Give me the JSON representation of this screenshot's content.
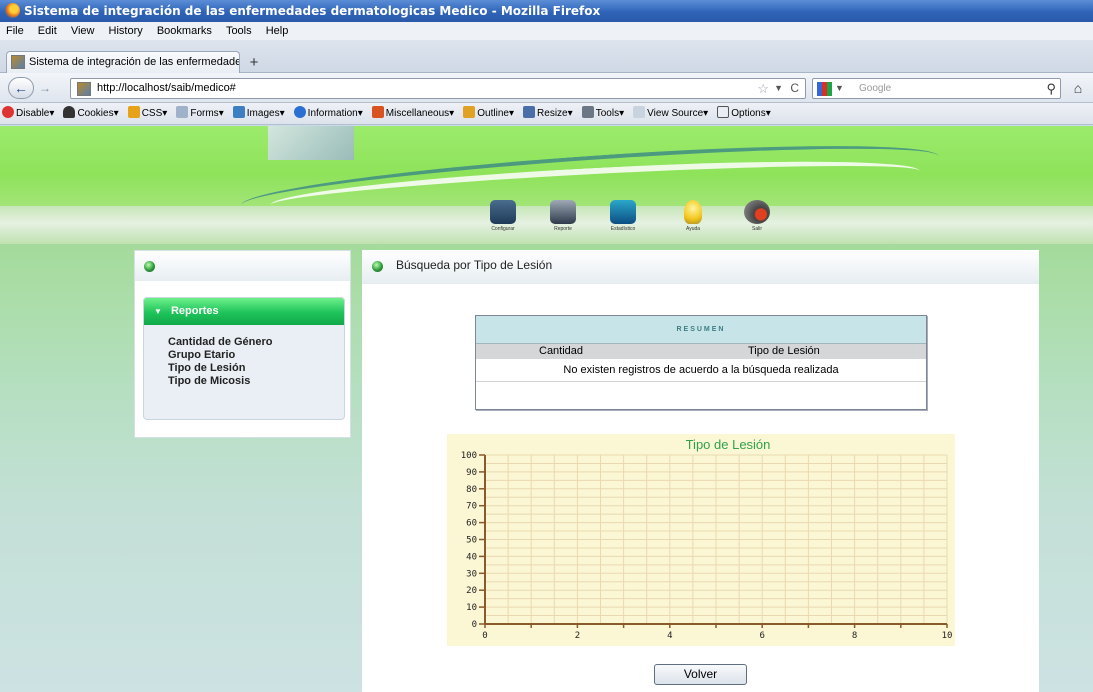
{
  "window": {
    "title": "Sistema de integración de las enfermedades dermatologicas Medico - Mozilla Firefox"
  },
  "menu": [
    "File",
    "Edit",
    "View",
    "History",
    "Bookmarks",
    "Tools",
    "Help"
  ],
  "tab": {
    "label": "Sistema de integración de las enfermedades ...",
    "new_tab": "+"
  },
  "navbar": {
    "url": "http://localhost/saib/medico#",
    "search_placeholder": "Google"
  },
  "devbar": [
    "Disable",
    "Cookies",
    "CSS",
    "Forms",
    "Images",
    "Information",
    "Miscellaneous",
    "Outline",
    "Resize",
    "Tools",
    "View Source",
    "Options"
  ],
  "site_nav": [
    "Configurar",
    "Reporte",
    "Estadístico",
    "Ayuda",
    "Salir"
  ],
  "sidebar": {
    "section_title": "Reportes",
    "items": [
      "Cantidad de Género",
      "Grupo Etario",
      "Tipo de Lesión",
      "Tipo de Micosis"
    ]
  },
  "main": {
    "heading": "Búsqueda por Tipo de Lesión",
    "summary": {
      "caption": "RESUMEN",
      "columns": [
        "Cantidad",
        "Tipo de Lesión"
      ],
      "empty_message": "No existen registros de acuerdo a la búsqueda realizada"
    },
    "back_button": "Volver"
  },
  "chart_data": {
    "type": "bar",
    "title": "Tipo de Lesión",
    "categories": [],
    "values": [],
    "xlim": [
      0,
      10
    ],
    "ylim": [
      0,
      100
    ],
    "x_ticks": [
      0,
      2,
      4,
      6,
      8,
      10
    ],
    "y_ticks": [
      0,
      10,
      20,
      30,
      40,
      50,
      60,
      70,
      80,
      90,
      100
    ],
    "grid": true,
    "title_color": "#2fa34a",
    "axis_color": "#8a5a2b"
  }
}
